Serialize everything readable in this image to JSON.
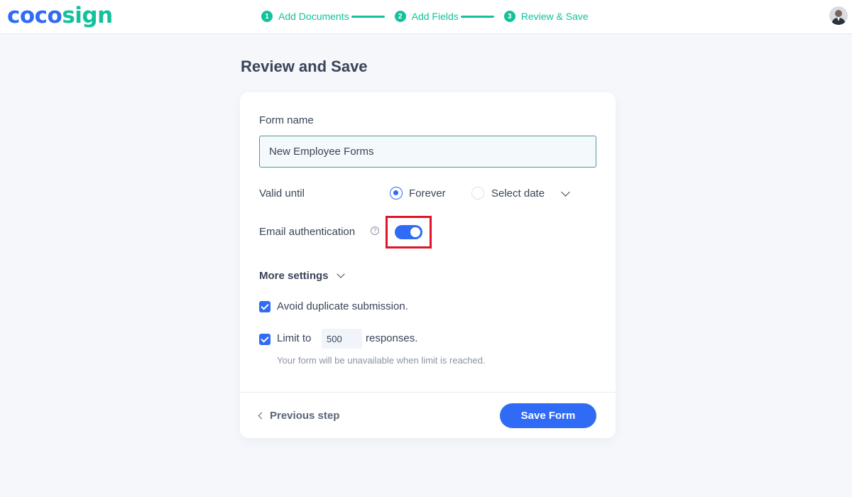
{
  "header": {
    "logo_part1": "coco",
    "logo_part2": "sign",
    "steps": [
      {
        "number": "1",
        "label": "Add Documents"
      },
      {
        "number": "2",
        "label": "Add Fields"
      },
      {
        "number": "3",
        "label": "Review & Save"
      }
    ],
    "avatar_icon": "user-avatar"
  },
  "page": {
    "title": "Review and Save"
  },
  "form": {
    "name_label": "Form name",
    "name_value": "New Employee Forms",
    "valid_until_label": "Valid until",
    "valid_options": [
      {
        "label": "Forever",
        "checked": true
      },
      {
        "label": "Select date",
        "checked": false
      }
    ],
    "email_auth_label": "Email authentication",
    "email_auth_help_icon": "help-circle-icon",
    "email_auth_enabled": true,
    "more_settings_label": "More settings",
    "avoid_duplicate_label": "Avoid duplicate submission.",
    "avoid_duplicate_checked": true,
    "limit_prefix": "Limit to",
    "limit_value": "500",
    "limit_suffix": "responses.",
    "limit_checked": true,
    "limit_hint": "Your form will be unavailable when limit is reached."
  },
  "footer": {
    "previous_label": "Previous step",
    "save_label": "Save Form"
  },
  "colors": {
    "brand_blue": "#2f6bf5",
    "brand_green": "#12c29a",
    "highlight_red": "#e0142a"
  }
}
